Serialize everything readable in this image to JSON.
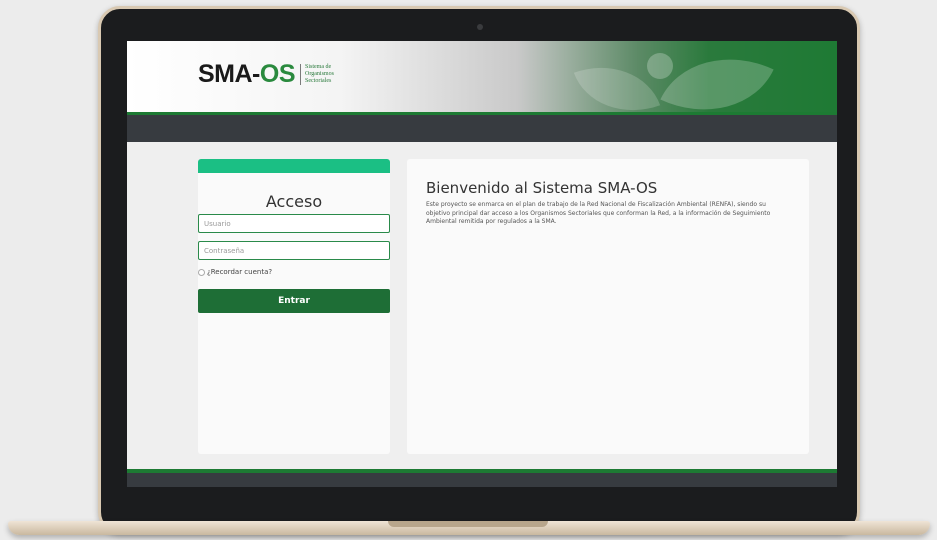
{
  "header": {
    "logo_main": "SMA-",
    "logo_accent": "OS",
    "logo_sub_line1": "Sistema de",
    "logo_sub_line2": "Organismos",
    "logo_sub_line3": "Sectoriales"
  },
  "login": {
    "title": "Acceso",
    "username_placeholder": "Usuario",
    "password_placeholder": "Contraseña",
    "remember_label": "¿Recordar cuenta?",
    "submit_label": "Entrar"
  },
  "welcome": {
    "title": "Bienvenido al Sistema SMA-OS",
    "body": "Este proyecto se enmarca en el plan de trabajo de la Red Nacional de Fiscalización Ambiental (RENFA), siendo su objetivo principal dar acceso a los Organismos Sectoriales que conforman la Red, a la información de Seguimiento Ambiental remitida por regulados a la SMA."
  },
  "colors": {
    "brand_green": "#1e6e36",
    "accent_teal": "#1bbf84",
    "nav_dark": "#373b40"
  }
}
